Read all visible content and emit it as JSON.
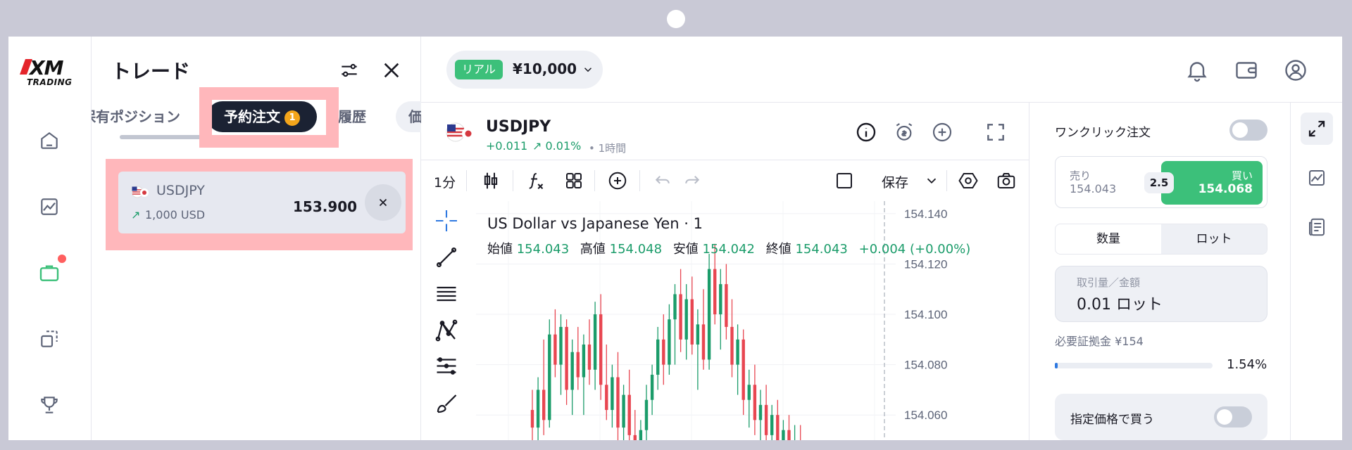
{
  "brand": {
    "logo": "XM",
    "logo_sub": "TRADING"
  },
  "rail": {
    "items": [
      {
        "icon": "home-icon"
      },
      {
        "icon": "chart-icon"
      },
      {
        "icon": "briefcase-icon",
        "active": true,
        "badge": true
      },
      {
        "icon": "copy-icon"
      },
      {
        "icon": "trophy-icon"
      }
    ]
  },
  "panel": {
    "title": "トレード",
    "tabs": [
      {
        "label": "保有ポジション"
      },
      {
        "label": "予約注文",
        "count": "1",
        "active": true
      },
      {
        "label": "履歴"
      },
      {
        "label": "価"
      }
    ],
    "order": {
      "symbol": "USDJPY",
      "volume": "1,000 USD",
      "price": "153.900"
    }
  },
  "header": {
    "account_type": "リアル",
    "balance": "¥10,000"
  },
  "instrument": {
    "symbol": "USDJPY",
    "change": "+0.011",
    "change_pct": "0.01%",
    "timeframe": "• 1時間"
  },
  "toolbar": {
    "interval": "1分",
    "save_label": "保存"
  },
  "chart_data": {
    "type": "candlestick",
    "title": "US Dollar vs Japanese Yen · 1",
    "legend": {
      "open_label": "始値",
      "open": "154.043",
      "high_label": "高値",
      "high": "154.048",
      "low_label": "安値",
      "low": "154.042",
      "close_label": "終値",
      "close": "154.043",
      "change": "+0.004 (+0.00%)"
    },
    "y_ticks": [
      "154.140",
      "154.120",
      "154.100",
      "154.080",
      "154.060"
    ],
    "ylim": [
      154.05,
      154.145
    ],
    "candles": [
      {
        "o": 154.062,
        "h": 154.07,
        "l": 154.05,
        "c": 154.055
      },
      {
        "o": 154.055,
        "h": 154.075,
        "l": 154.05,
        "c": 154.07
      },
      {
        "o": 154.07,
        "h": 154.09,
        "l": 154.052,
        "c": 154.058
      },
      {
        "o": 154.058,
        "h": 154.098,
        "l": 154.055,
        "c": 154.092
      },
      {
        "o": 154.092,
        "h": 154.102,
        "l": 154.075,
        "c": 154.08
      },
      {
        "o": 154.08,
        "h": 154.1,
        "l": 154.068,
        "c": 154.095
      },
      {
        "o": 154.095,
        "h": 154.098,
        "l": 154.064,
        "c": 154.07
      },
      {
        "o": 154.07,
        "h": 154.09,
        "l": 154.06,
        "c": 154.085
      },
      {
        "o": 154.085,
        "h": 154.095,
        "l": 154.07,
        "c": 154.075
      },
      {
        "o": 154.075,
        "h": 154.092,
        "l": 154.06,
        "c": 154.088
      },
      {
        "o": 154.088,
        "h": 154.098,
        "l": 154.072,
        "c": 154.078
      },
      {
        "o": 154.078,
        "h": 154.105,
        "l": 154.07,
        "c": 154.1
      },
      {
        "o": 154.1,
        "h": 154.108,
        "l": 154.066,
        "c": 154.072
      },
      {
        "o": 154.072,
        "h": 154.088,
        "l": 154.058,
        "c": 154.062
      },
      {
        "o": 154.062,
        "h": 154.08,
        "l": 154.055,
        "c": 154.075
      },
      {
        "o": 154.075,
        "h": 154.085,
        "l": 154.05,
        "c": 154.055
      },
      {
        "o": 154.055,
        "h": 154.072,
        "l": 154.048,
        "c": 154.068
      },
      {
        "o": 154.068,
        "h": 154.078,
        "l": 154.05,
        "c": 154.052
      },
      {
        "o": 154.052,
        "h": 154.062,
        "l": 154.04,
        "c": 154.045
      },
      {
        "o": 154.045,
        "h": 154.058,
        "l": 154.036,
        "c": 154.054
      },
      {
        "o": 154.054,
        "h": 154.072,
        "l": 154.048,
        "c": 154.066
      },
      {
        "o": 154.066,
        "h": 154.08,
        "l": 154.06,
        "c": 154.076
      },
      {
        "o": 154.076,
        "h": 154.095,
        "l": 154.07,
        "c": 154.09
      },
      {
        "o": 154.09,
        "h": 154.1,
        "l": 154.072,
        "c": 154.08
      },
      {
        "o": 154.08,
        "h": 154.104,
        "l": 154.076,
        "c": 154.098
      },
      {
        "o": 154.098,
        "h": 154.112,
        "l": 154.08,
        "c": 154.108
      },
      {
        "o": 154.108,
        "h": 154.118,
        "l": 154.085,
        "c": 154.09
      },
      {
        "o": 154.09,
        "h": 154.112,
        "l": 154.082,
        "c": 154.106
      },
      {
        "o": 154.106,
        "h": 154.115,
        "l": 154.084,
        "c": 154.088
      },
      {
        "o": 154.088,
        "h": 154.102,
        "l": 154.07,
        "c": 154.096
      },
      {
        "o": 154.096,
        "h": 154.11,
        "l": 154.078,
        "c": 154.082
      },
      {
        "o": 154.082,
        "h": 154.124,
        "l": 154.078,
        "c": 154.118
      },
      {
        "o": 154.118,
        "h": 154.128,
        "l": 154.096,
        "c": 154.1
      },
      {
        "o": 154.1,
        "h": 154.118,
        "l": 154.086,
        "c": 154.112
      },
      {
        "o": 154.112,
        "h": 154.12,
        "l": 154.09,
        "c": 154.095
      },
      {
        "o": 154.095,
        "h": 154.106,
        "l": 154.075,
        "c": 154.08
      },
      {
        "o": 154.08,
        "h": 154.096,
        "l": 154.068,
        "c": 154.09
      },
      {
        "o": 154.09,
        "h": 154.094,
        "l": 154.06,
        "c": 154.066
      },
      {
        "o": 154.066,
        "h": 154.078,
        "l": 154.055,
        "c": 154.072
      },
      {
        "o": 154.072,
        "h": 154.08,
        "l": 154.052,
        "c": 154.058
      },
      {
        "o": 154.058,
        "h": 154.07,
        "l": 154.048,
        "c": 154.064
      },
      {
        "o": 154.064,
        "h": 154.072,
        "l": 154.046,
        "c": 154.052
      },
      {
        "o": 154.052,
        "h": 154.064,
        "l": 154.044,
        "c": 154.06
      },
      {
        "o": 154.06,
        "h": 154.066,
        "l": 154.04,
        "c": 154.046
      },
      {
        "o": 154.046,
        "h": 154.058,
        "l": 154.04,
        "c": 154.054
      },
      {
        "o": 154.054,
        "h": 154.06,
        "l": 154.038,
        "c": 154.044
      },
      {
        "o": 154.044,
        "h": 154.056,
        "l": 154.038,
        "c": 154.05
      },
      {
        "o": 154.05,
        "h": 154.056,
        "l": 154.036,
        "c": 154.04
      }
    ]
  },
  "order_entry": {
    "one_click_label": "ワンクリック注文",
    "sell_label": "売り",
    "sell_price": "154.043",
    "buy_label": "買い",
    "buy_price": "154.068",
    "spread": "2.5",
    "unit_quantity": "数量",
    "unit_lot": "ロット",
    "amount_label": "取引量／金額",
    "amount_value": "0.01 ロット",
    "margin_label": "必要証拠金 ¥154",
    "margin_pct": "1.54%",
    "margin_fraction": 0.0154,
    "limit_label": "指定価格で買う"
  },
  "colors": {
    "up": "#1b9c6a",
    "down": "#e84651",
    "accent": "#3cc07a",
    "highlight": "#ffb7bb"
  }
}
